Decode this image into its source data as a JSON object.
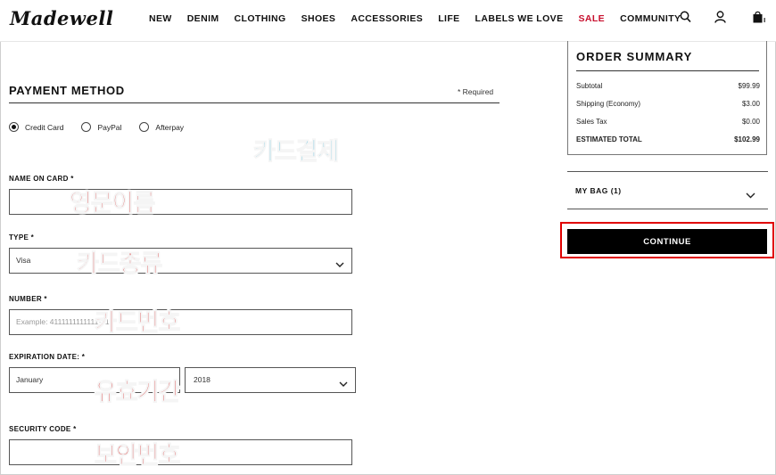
{
  "header": {
    "logo": "Madewell",
    "nav": [
      "NEW",
      "DENIM",
      "CLOTHING",
      "SHOES",
      "ACCESSORIES",
      "LIFE",
      "LABELS WE LOVE",
      "SALE",
      "COMMUNITY"
    ],
    "sale_color": "#c8102e",
    "icons": [
      "search-icon",
      "account-icon",
      "bag-icon"
    ]
  },
  "payment": {
    "title": "PAYMENT METHOD",
    "required_note": "* Required",
    "options": [
      "Credit Card",
      "PayPal",
      "Afterpay"
    ],
    "selected": "Credit Card",
    "name_on_card": {
      "label": "NAME ON CARD *",
      "value": ""
    },
    "type": {
      "label": "TYPE *",
      "value": "Visa"
    },
    "number": {
      "label": "NUMBER *",
      "placeholder": "Example: 4111111111111111"
    },
    "expiration": {
      "label": "EXPIRATION DATE:  *",
      "month": "January",
      "year": "2018"
    },
    "security_code": {
      "label": "SECURITY CODE *",
      "value": ""
    }
  },
  "annotations": {
    "card_payment": "카드결제",
    "english_name": "영문이름",
    "card_type": "카드종류",
    "card_number": "카드번호",
    "expiry": "유효기간",
    "security": "보안번호",
    "red_color": "#d10000",
    "blue_color": "#1aa7cf"
  },
  "summary": {
    "title": "ORDER SUMMARY",
    "rows": [
      {
        "label": "Subtotal",
        "value": "$99.99"
      },
      {
        "label": "Shipping (Economy)",
        "value": "$3.00"
      },
      {
        "label": "Sales Tax",
        "value": "$0.00"
      },
      {
        "label": "ESTIMATED TOTAL",
        "value": "$102.99"
      }
    ],
    "bag_label": "MY BAG (1)",
    "continue_label": "CONTINUE"
  }
}
